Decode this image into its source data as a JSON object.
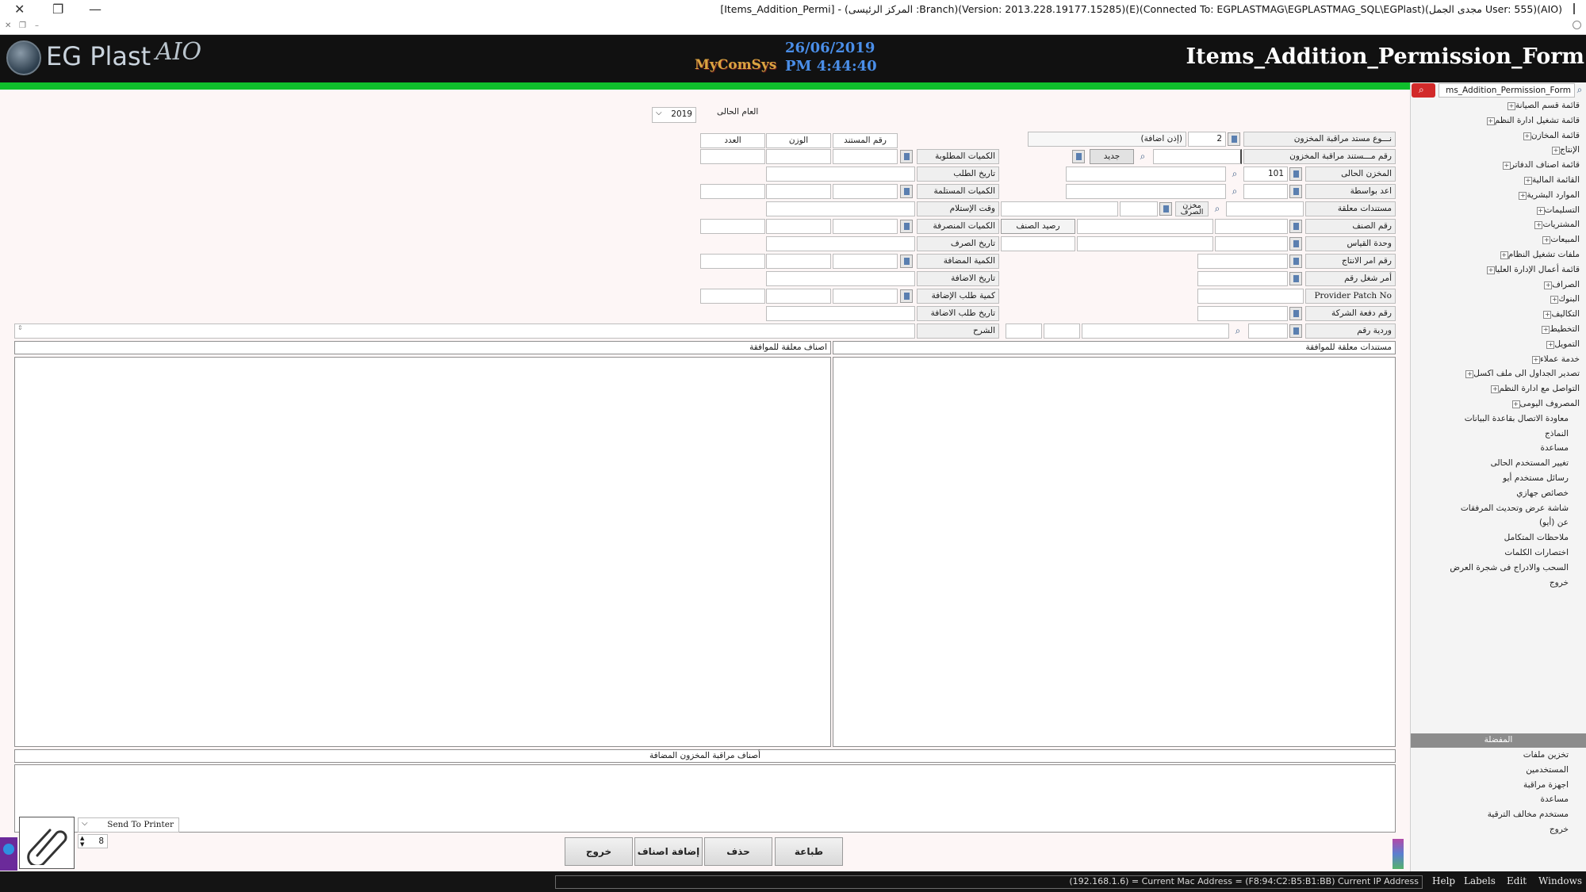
{
  "window": {
    "title": "[Items_Addition_Permi] - (المركز الرئيسى :Branch)(Version: 2013.228.19177.15285)(E)(Connected To: EGPLASTMAG\\EGPLASTMAG_SQL\\EGPlast)(مجدى الجمل User: 555)(AIO)",
    "close_glyph": "✕",
    "restore_glyph": "❐",
    "minimize_glyph": "—",
    "mini_controls": [
      "✕",
      "❐",
      "–"
    ]
  },
  "header": {
    "logo_text": "EG Plast",
    "logo_aio": "AIO",
    "mycomsys": "MyComSys",
    "date": "26/06/2019",
    "time": "PM 4:44:40",
    "form_title": "Items_Addition_Permission_Form"
  },
  "form": {
    "current_year_label": "العام الحالى",
    "current_year_value": "2019",
    "right": {
      "doc_type_label": "نـــوع مستد مراقبة المخزون",
      "doc_type_code": "2",
      "doc_type_name": "(إذن اضافة)",
      "doc_no_label": "رقم مـــستند مراقبة المخزون",
      "new_button": "جديد",
      "current_store_label": "المخزن الحالى",
      "current_store_value": "101",
      "prepared_by_label": "اعد بواسطة",
      "pending_docs_label": "مستندات معلقة",
      "issue_store_label": "مخزن الصرف",
      "item_no_label": "رقم الصنف",
      "item_balance_label": "رصيد الصنف",
      "uom_label": "وحدة القياس",
      "production_order_label": "رقم امر الانتاج",
      "work_order_label": "أمر شغل رقم",
      "provider_patch_label": "Provider Patch No",
      "company_batch_label": "رقم دفعة الشركة",
      "shift_no_label": "وردية رقم"
    },
    "middle": {
      "requested_qty_label": "الكميات المطلوبة",
      "request_date_label": "تاريخ الطلب",
      "received_qty_label": "الكميات المستلمة",
      "receive_time_label": "وقت الإستلام",
      "issued_qty_label": "الكميات المنصرفة",
      "issue_date_label": "تاريخ الصرف",
      "added_qty_label": "الكمية المضافة",
      "add_date_label": "تاريخ الاضافة",
      "add_request_qty_label": "كمية طلب الإضافة",
      "add_request_date_label": "تاريخ طلب الاضافة",
      "notes_label": "الشرح"
    },
    "columns": {
      "doc_no": "رقم المستند",
      "weight": "الوزن",
      "count": "العدد"
    }
  },
  "panels": {
    "pending_docs_header": "مستندات معلقة للموافقة",
    "pending_items_header": "اصناف معلقة للموافقة",
    "added_items_header": "أصناف مراقبة المخزون المضافة"
  },
  "bottom": {
    "printer_option": "Send To Printer",
    "copies": "8",
    "buttons": {
      "exit": "خروج",
      "add_items": "إضافة اصناف",
      "delete": "حذف",
      "print": "طباعة"
    }
  },
  "sidebar": {
    "search_value": "ms_Addition_Permission_Form",
    "items": [
      "قائمة قسم الصيانة",
      "قائمة تشغيل ادارة النظم",
      "قائمة المخازن",
      "الإنتاج",
      "قائمة اصناف الدفاتر",
      "القائمة المالية",
      "الموارد البشرية",
      "التسليمات",
      "المشتريات",
      "المبيعات",
      "ملفات تشغيل النظام",
      "قائمة أعمال الإدارة العليا",
      "الصراف",
      "البنوك",
      "التكاليف",
      "التخطيط",
      "التمويل",
      "خدمة عملاء",
      "تصدير الجداول الى ملف اكسل",
      "التواصل مع ادارة النظم",
      "المصروف اليومى"
    ],
    "plain_items": [
      "معاودة الاتصال بقاعدة البيانات",
      "النماذج",
      "مساعدة",
      "تغيير المستخدم الحالى",
      "رسائل مستخدم أيو",
      "خصائص جهازي",
      "شاشة عرض وتحديث المرفقات",
      "عن (أيو)",
      "ملاحظات المتكامل",
      "اختصارات الكلمات",
      "السحب والادراج فى شجرة العرض",
      "خروج"
    ],
    "section_title": "المفضلة",
    "favorites": [
      "تخزين ملفات",
      "المستخدمين",
      "اجهزة مراقبة",
      "مساعدة",
      "مستخدم مخالف الترقية",
      "خروج"
    ]
  },
  "statusbar": {
    "text": "(192.168.1.6) = Current Mac Address = (F8:94:C2:B5:B1:BB) Current IP Address",
    "menu": [
      "Help",
      "Labels",
      "Edit",
      "Windows"
    ]
  },
  "colors": {
    "header_bg": "#111111",
    "green_bar": "#0fbf2c",
    "date_blue": "#4a8ee8",
    "search_red": "#d22a2a"
  }
}
